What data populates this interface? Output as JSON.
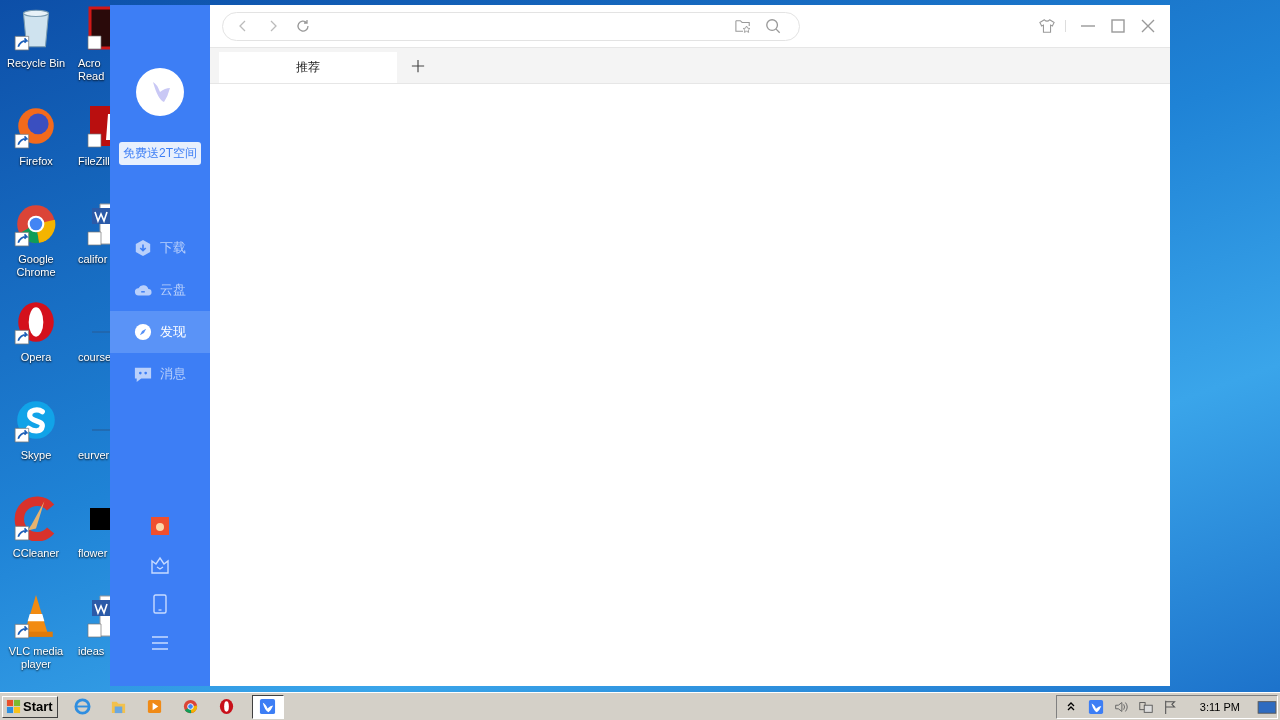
{
  "desktop": {
    "icons": [
      {
        "label": "Recycle Bin",
        "kind": "bin"
      },
      {
        "label": "Firefox",
        "kind": "firefox"
      },
      {
        "label": "Google Chrome",
        "kind": "chrome"
      },
      {
        "label": "Opera",
        "kind": "opera"
      },
      {
        "label": "Skype",
        "kind": "skype"
      },
      {
        "label": "CCleaner",
        "kind": "ccleaner"
      },
      {
        "label": "VLC media player",
        "kind": "vlc"
      }
    ],
    "partly_hidden_icons": [
      {
        "label": "Acro Read",
        "kind": "acrobat"
      },
      {
        "label": "FileZill",
        "kind": "filezilla"
      },
      {
        "label": "califor",
        "kind": "word"
      },
      {
        "label": "course",
        "kind": "blank"
      },
      {
        "label": "eurver",
        "kind": "blank"
      },
      {
        "label": "flower",
        "kind": "image"
      },
      {
        "label": "ideas",
        "kind": "word"
      }
    ]
  },
  "app": {
    "promo_badge": "免费送2T空间",
    "nav": [
      {
        "label": "下载",
        "kind": "download",
        "selected": false
      },
      {
        "label": "云盘",
        "kind": "cloud",
        "selected": false
      },
      {
        "label": "发现",
        "kind": "compass",
        "selected": true
      },
      {
        "label": "消息",
        "kind": "chat",
        "selected": false
      }
    ],
    "tabs": [
      {
        "label": "推荐",
        "selected": true
      }
    ]
  },
  "taskbar": {
    "start": "Start",
    "apps": [
      {
        "kind": "ie",
        "selected": false
      },
      {
        "kind": "folder",
        "selected": false
      },
      {
        "kind": "media",
        "selected": false
      },
      {
        "kind": "chrome",
        "selected": false
      },
      {
        "kind": "opera",
        "selected": false
      },
      {
        "kind": "bird",
        "selected": true
      }
    ],
    "clock": "3:11 PM"
  }
}
